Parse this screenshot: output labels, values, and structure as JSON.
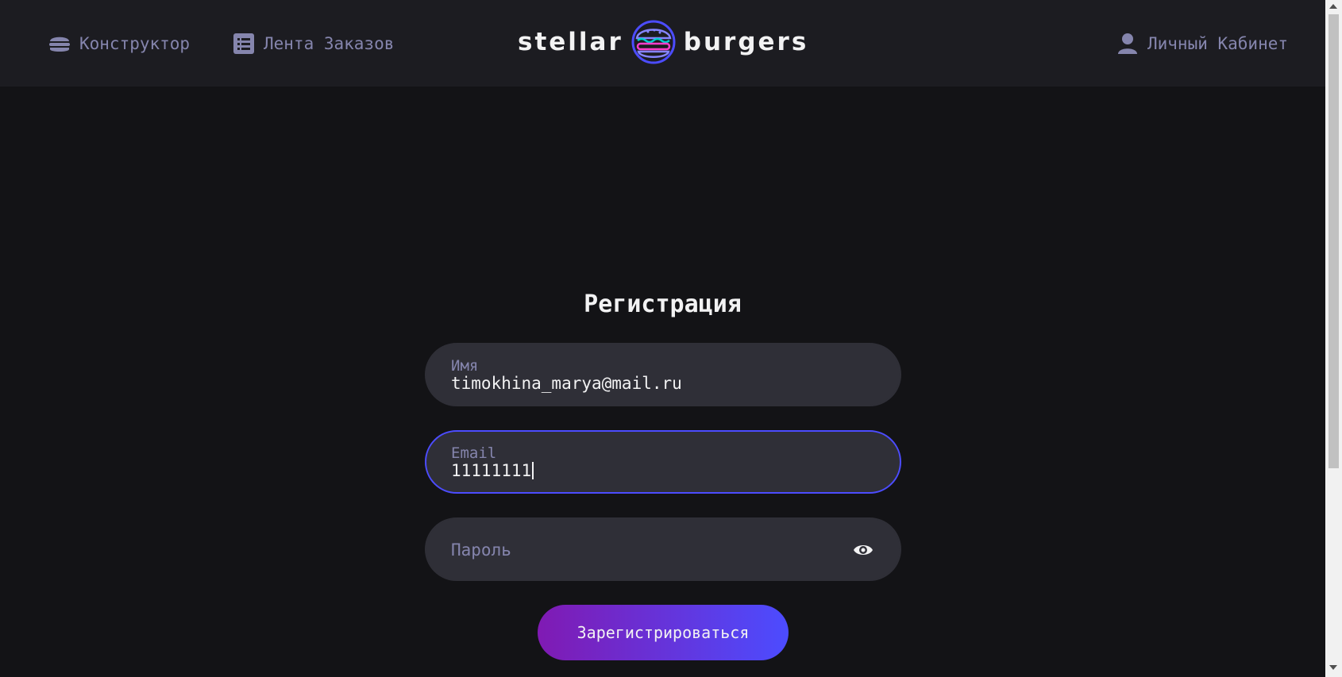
{
  "header": {
    "nav": {
      "constructor_label": "Конструктор",
      "feed_label": "Лента Заказов",
      "account_label": "Личный Кабинет"
    },
    "logo": {
      "left_word": "stellar",
      "right_word": "burgers"
    }
  },
  "form": {
    "title": "Регистрация",
    "name": {
      "label": "Имя",
      "value": "timokhina_marya@mail.ru"
    },
    "email": {
      "label": "Email",
      "value": "11111111"
    },
    "password": {
      "placeholder": "Пароль"
    },
    "submit_label": "Зарегистрироваться"
  },
  "icons": {
    "constructor": "burger-icon",
    "feed": "list-icon",
    "account": "profile-icon",
    "password_toggle": "eye-icon"
  },
  "colors": {
    "background": "#131316",
    "header": "#1C1C21",
    "input": "#2F2F37",
    "accent": "#4C4CFF",
    "muted_text": "#8585AD",
    "button_gradient_start": "#801AB3",
    "button_gradient_end": "#4C4CFF"
  }
}
